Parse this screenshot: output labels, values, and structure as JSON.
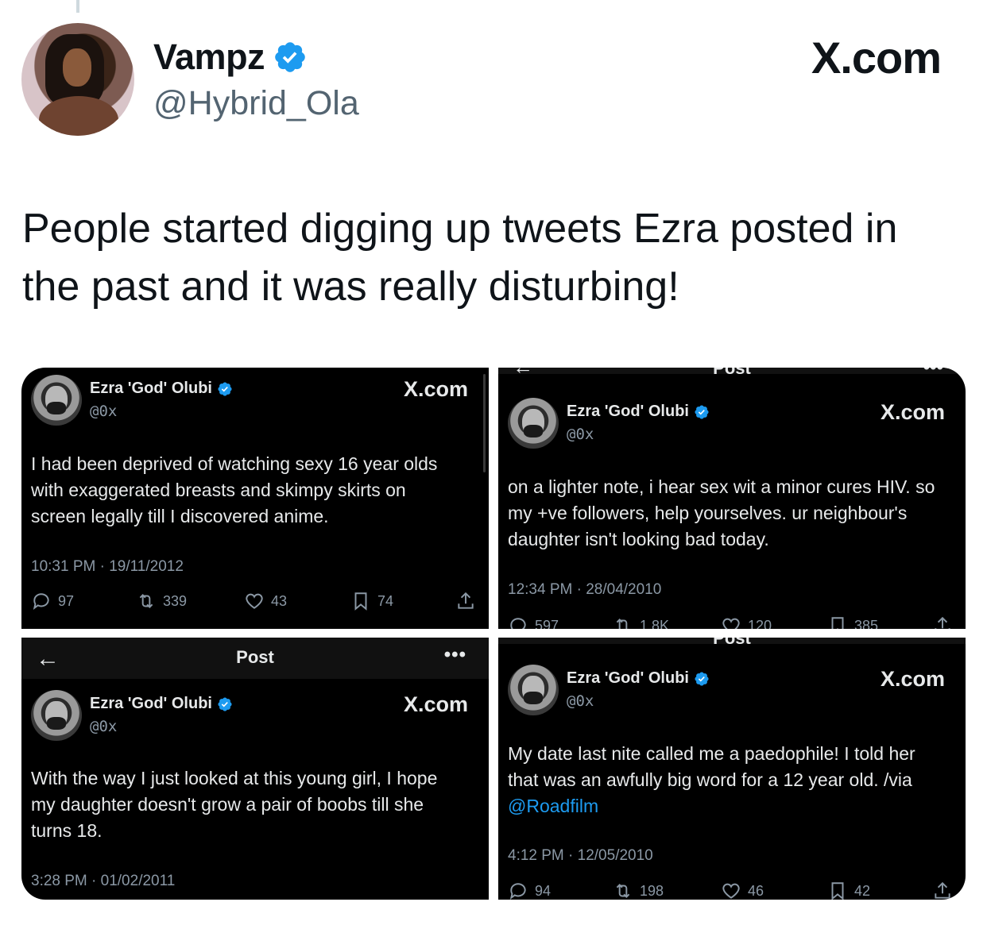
{
  "post": {
    "author": {
      "name": "Vampz",
      "handle": "@Hybrid_Ola"
    },
    "brand": "X.com",
    "text": "People started digging up tweets Ezra posted in the past and it was really disturbing!"
  },
  "colors": {
    "verified": "#1d9bf0",
    "panel_bg": "#000000",
    "muted": "#8b98a5"
  },
  "screenshots": [
    {
      "author": "Ezra 'God' Olubi",
      "handle": "@0x",
      "brand": "X.com",
      "text": "I had been deprived of watching sexy 16 year olds with exaggerated breasts and skimpy skirts on screen legally till I discovered anime.",
      "timestamp": "10:31 PM · 19/11/2012",
      "replies": "97",
      "reposts": "339",
      "likes": "43",
      "bookmarks": "74"
    },
    {
      "header_title": "Post",
      "author": "Ezra 'God' Olubi",
      "handle": "@0x",
      "brand": "X.com",
      "text": "on a lighter note, i hear sex wit a minor cures HIV. so my +ve followers, help yourselves. ur neighbour's daughter isn't looking bad today.",
      "timestamp": "12:34 PM · 28/04/2010",
      "replies": "597",
      "reposts": "1.8K",
      "likes": "120",
      "bookmarks": "385"
    },
    {
      "header_title": "Post",
      "author": "Ezra 'God' Olubi",
      "handle": "@0x",
      "brand": "X.com",
      "text": "With the way I just looked at this young girl, I hope my daughter doesn't grow a pair of boobs till she turns 18.",
      "timestamp": "3:28 PM · 01/02/2011"
    },
    {
      "header_title": "Post",
      "author": "Ezra 'God' Olubi",
      "handle": "@0x",
      "brand": "X.com",
      "text": "My date last nite called me a paedophile! I told her that was an awfully big word for a 12 year old. /via",
      "mention": "@Roadfilm",
      "timestamp": "4:12 PM · 12/05/2010",
      "replies": "94",
      "reposts": "198",
      "likes": "46",
      "bookmarks": "42"
    }
  ]
}
